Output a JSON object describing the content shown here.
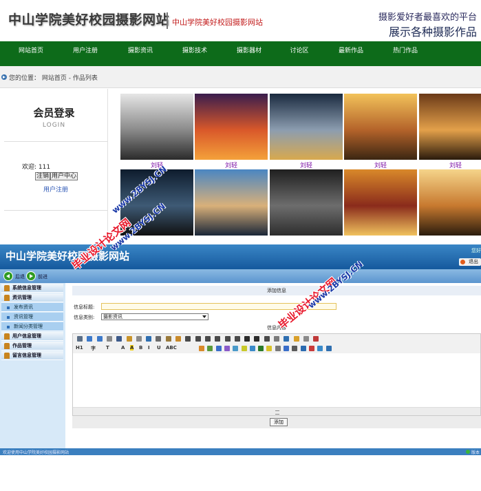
{
  "site": {
    "logo": "中山学院美好校园摄影网站",
    "logo_sub": "中山学院美好校园摄影网站",
    "slogan_line1": "摄影爱好者最喜欢的平台",
    "slogan_line2": "展示各种摄影作品",
    "nav": [
      "网站首页",
      "用户注册",
      "摄影资讯",
      "摄影技术",
      "摄影器材",
      "讨论区",
      "最新作品",
      "热门作品"
    ],
    "breadcrumb": "您的位置： 网站首页 - 作品列表",
    "login": {
      "title": "会员登录",
      "subtitle": "LOGIN",
      "welcome": "欢迎: 111",
      "logout": "注销",
      "center": "用户中心",
      "register": "用户注册"
    },
    "photos": [
      {
        "caption": "刘轻",
        "colors": [
          "#e6e6e6",
          "#8a8a8a",
          "#2b2b2b"
        ]
      },
      {
        "caption": "刘轻",
        "colors": [
          "#3a1d4d",
          "#d9582a",
          "#f4a13a"
        ]
      },
      {
        "caption": "刘轻",
        "colors": [
          "#1a2a3f",
          "#8c9db0",
          "#d8a94e"
        ]
      },
      {
        "caption": "刘轻",
        "colors": [
          "#f2c25a",
          "#b4632a",
          "#3b2612"
        ]
      },
      {
        "caption": "刘轻",
        "colors": [
          "#6b3a18",
          "#e3a04a",
          "#2a1a0c"
        ]
      },
      {
        "caption": "",
        "colors": [
          "#0e1c2d",
          "#3e5a75",
          "#101010"
        ]
      },
      {
        "caption": "",
        "colors": [
          "#4a86c2",
          "#d9b07a",
          "#1a2638"
        ]
      },
      {
        "caption": "",
        "colors": [
          "#1f1f1f",
          "#6d6d6d",
          "#2d2d2d"
        ]
      },
      {
        "caption": "",
        "colors": [
          "#d9892a",
          "#8a2b1b",
          "#f0c25e"
        ]
      },
      {
        "caption": "",
        "colors": [
          "#f5d48a",
          "#c7792f",
          "#2a1c0d"
        ]
      }
    ]
  },
  "admin": {
    "title": "中山学院美好校园摄影网站",
    "user_text": "您好",
    "logout_text": "退出",
    "toolbar": {
      "back": "后退",
      "forward": "前进"
    },
    "menu": [
      {
        "label": "系统信息管理",
        "type": "main"
      },
      {
        "label": "资讯管理",
        "type": "main"
      },
      {
        "label": "发布资讯",
        "type": "sub"
      },
      {
        "label": "资讯管理",
        "type": "sub"
      },
      {
        "label": "新闻分类管理",
        "type": "sub"
      },
      {
        "label": "用户信息管理",
        "type": "main"
      },
      {
        "label": "作品管理",
        "type": "main"
      },
      {
        "label": "留言信息管理",
        "type": "main"
      }
    ],
    "form": {
      "header": "添加信息",
      "title_label": "信息标题:",
      "title_value": "",
      "category_label": "信息类别:",
      "category_value": "摄影资讯",
      "content_label": "信息内容",
      "editor_row2": [
        "H1",
        "字",
        "T",
        "A",
        "A",
        "B",
        "I",
        "U",
        "ABC"
      ],
      "submit": "添加"
    },
    "footer": "欢迎使用中山学院美好校园摄影网站",
    "footer_right": "版本"
  },
  "watermarks": {
    "red": [
      "毕业设计论文网",
      "毕业设计论文网"
    ],
    "blue": [
      "www.2BYSJ.CN",
      "www.2BYSJ.CN",
      "www.2BYSJ.CN"
    ]
  }
}
